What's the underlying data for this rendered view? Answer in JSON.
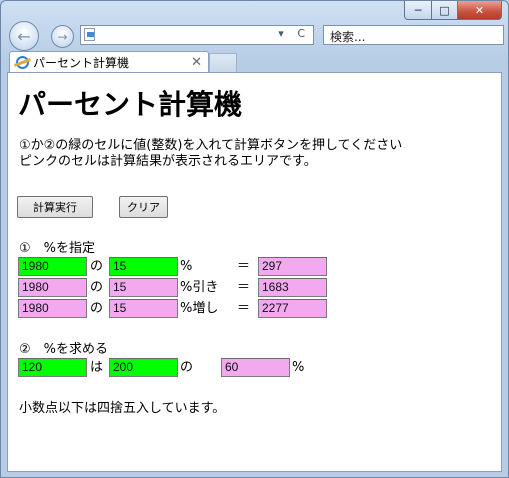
{
  "window": {
    "min_label": "─",
    "max_label": "□",
    "close_label": "✕"
  },
  "nav": {
    "back": "←",
    "forward": "→",
    "addr_tools": "▾ C",
    "search_placeholder": "検索..."
  },
  "tab": {
    "title": "パーセント計算機",
    "close": "✕"
  },
  "page": {
    "title": "パーセント計算機",
    "instr1": "①か②の緑のセルに値(整数)を入れて計算ボタンを押してください",
    "instr2": "ピンクのセルは計算結果が表示されるエリアです。",
    "calc_btn": "計算実行",
    "clear_btn": "クリア",
    "sec1_title": "①　%を指定",
    "sec1_rows": [
      {
        "a": "1980",
        "op": "の",
        "b": "15",
        "suffix": "%",
        "eq": "＝",
        "result": "297"
      },
      {
        "a": "1980",
        "op": "の",
        "b": "15",
        "suffix": "%引き",
        "eq": "＝",
        "result": "1683"
      },
      {
        "a": "1980",
        "op": "の",
        "b": "15",
        "suffix": "%増し",
        "eq": "＝",
        "result": "2277"
      }
    ],
    "sec2_title": "②　%を求める",
    "sec2_row": {
      "a": "120",
      "op1": "は",
      "b": "200",
      "op2": "の",
      "result": "60",
      "suffix": "%"
    },
    "note": "小数点以下は四捨五入しています。"
  },
  "colors": {
    "input": "#00ff00",
    "output": "#f3a9f0"
  }
}
